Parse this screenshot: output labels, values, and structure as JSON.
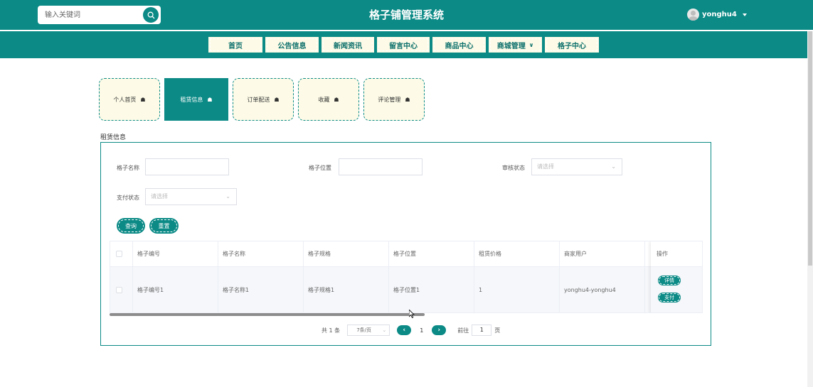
{
  "header": {
    "search_placeholder": "输入关键词",
    "app_title": "格子铺管理系统",
    "username": "yonghu4"
  },
  "nav": [
    {
      "label": "首页",
      "width": 78
    },
    {
      "label": "公告信息",
      "width": 77
    },
    {
      "label": "新闻资讯",
      "width": 76
    },
    {
      "label": "留言中心",
      "width": 76
    },
    {
      "label": "商品中心",
      "width": 77
    },
    {
      "label": "商城管理",
      "width": 77,
      "has_dropdown": true
    },
    {
      "label": "格子中心",
      "width": 78
    }
  ],
  "tabs": [
    {
      "label": "个人首页",
      "active": false
    },
    {
      "label": "租赁信息",
      "active": true
    },
    {
      "label": "订单配送",
      "active": false
    },
    {
      "label": "收藏",
      "active": false
    },
    {
      "label": "评论管理",
      "active": false
    }
  ],
  "section_title": "租赁信息",
  "filters": {
    "grid_name_label": "格子名称",
    "grid_position_label": "格子位置",
    "review_status_label": "审核状态",
    "review_status_placeholder": "请选择",
    "pay_status_label": "支付状态",
    "pay_status_placeholder": "请选择",
    "query_button": "查询",
    "reset_button": "重置"
  },
  "table": {
    "columns": [
      "格子编号",
      "格子名称",
      "格子规格",
      "格子位置",
      "租赁价格",
      "商家用户"
    ],
    "op_header": "操作",
    "rows": [
      {
        "cells": [
          "格子编号1",
          "格子名称1",
          "格子规格1",
          "格子位置1",
          "1",
          "yonghu4-yonghu4"
        ],
        "detail": "详情",
        "pay": "支付"
      }
    ]
  },
  "pagination": {
    "total": "共 1 条",
    "page_size": "7条/页",
    "current_page": "1",
    "goto_label": "前往",
    "goto_value": "1",
    "page_unit": "页"
  }
}
